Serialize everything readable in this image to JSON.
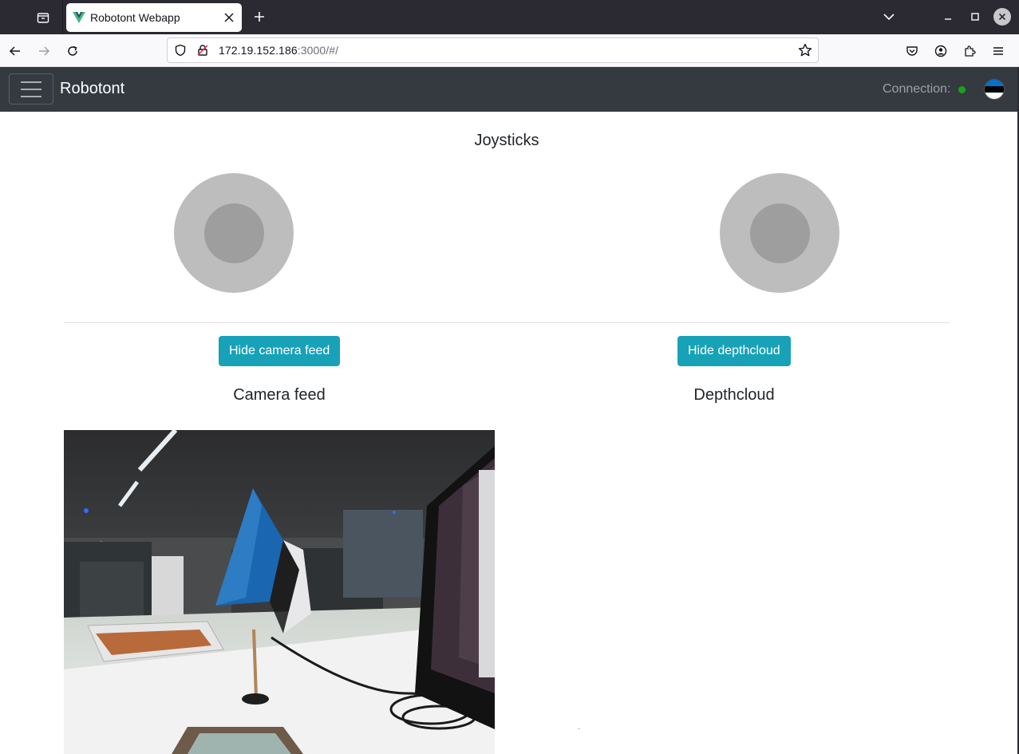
{
  "browser": {
    "tab_title": "Robotont Webapp",
    "url_host": "172.19.152.186",
    "url_rest": ":3000/#/"
  },
  "app": {
    "brand": "Robotont",
    "connection_label": "Connection:",
    "connection_status_color": "#17a317",
    "language_flag": "estonia-flag-icon"
  },
  "main": {
    "joysticks_title": "Joysticks",
    "hide_camera_button": "Hide camera feed",
    "hide_depthcloud_button": "Hide depthcloud",
    "camera_title": "Camera feed",
    "depthcloud_title": "Depthcloud"
  },
  "colors": {
    "navbar_bg": "#343a40",
    "button_bg": "#17a2b8",
    "joystick_outer": "#bdbdbd",
    "joystick_inner": "#9e9e9e"
  }
}
